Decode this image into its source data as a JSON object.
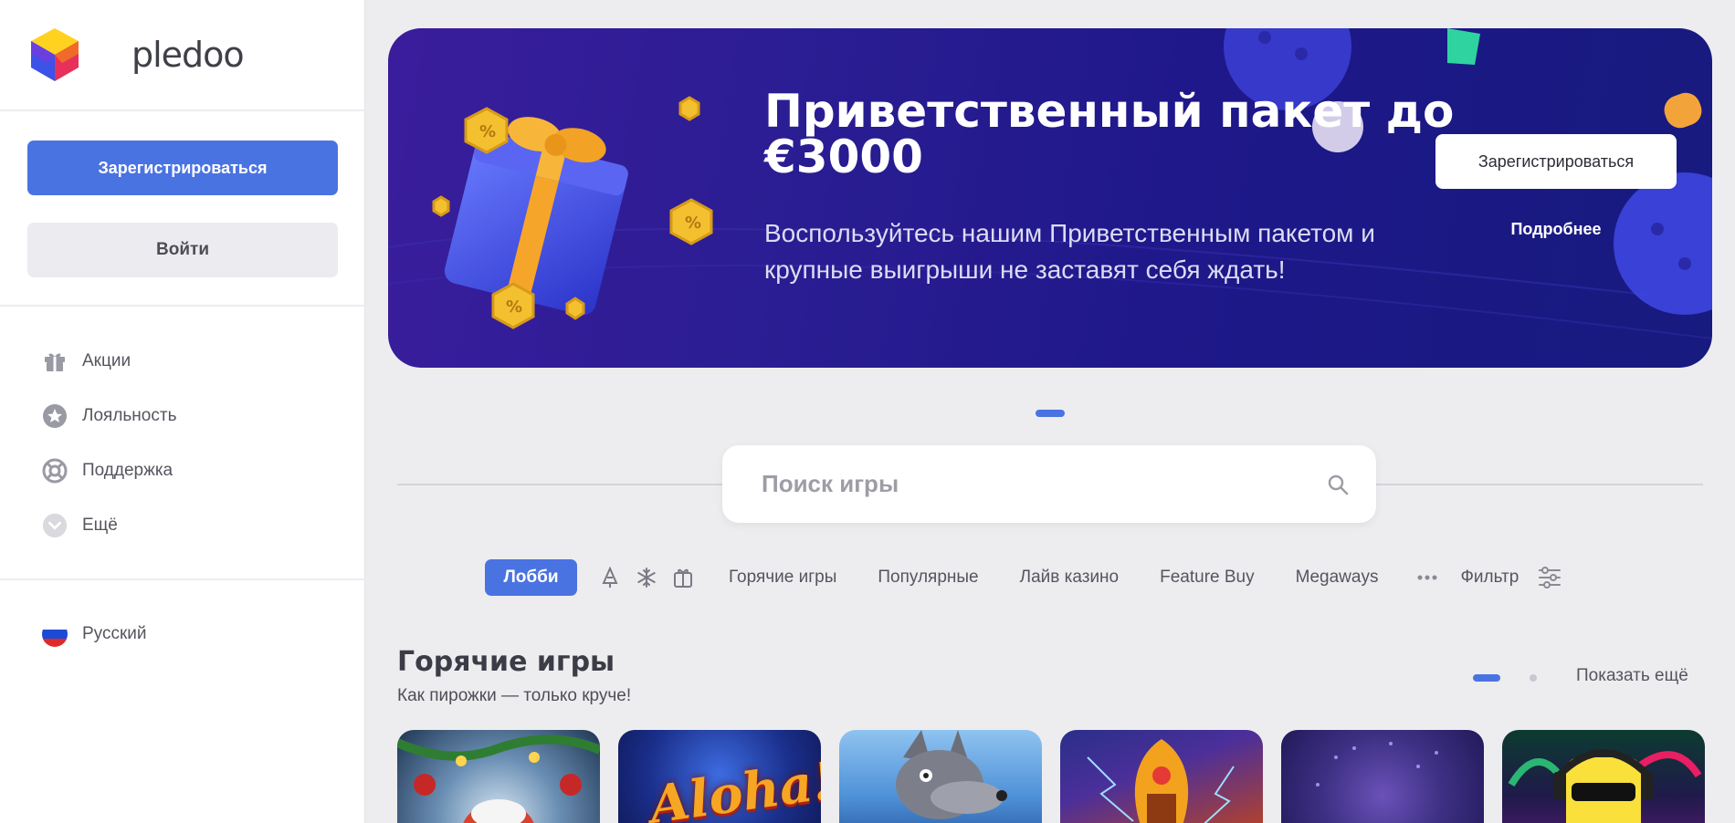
{
  "app": {
    "name": "pledoo"
  },
  "colors": {
    "accent": "#4a73e2",
    "banner_bg": "#231b8f",
    "sidebar_bg": "#ffffff",
    "page_bg": "#ededf0"
  },
  "sidebar": {
    "register_label": "Зарегистрироваться",
    "login_label": "Войти",
    "nav_items": [
      {
        "label": "Акции",
        "icon": "gift-icon"
      },
      {
        "label": "Лояльность",
        "icon": "star-icon"
      },
      {
        "label": "Поддержка",
        "icon": "lifebuoy-icon"
      },
      {
        "label": "Ещё",
        "icon": "chevron-down-icon"
      }
    ],
    "language": {
      "label": "Русский",
      "icon": "russia-flag-icon"
    }
  },
  "banner": {
    "title": "Приветственный пакет до €3000",
    "subtitle": "Воспользуйтесь нашим Приветственным пакетом и крупные выигрыши не заставят себя ждать!",
    "cta_label": "Зарегистрироваться",
    "more_label": "Подробнее",
    "slides_total": 1,
    "slide_active": 1
  },
  "search": {
    "placeholder": "Поиск игры"
  },
  "categories": {
    "active": "Лобби",
    "icons": [
      "christmas-tree-icon",
      "snowflake-icon",
      "gift-box-icon"
    ],
    "items": [
      "Горячие игры",
      "Популярные",
      "Лайв казино",
      "Feature Buy",
      "Megaways"
    ],
    "filter_label": "Фильтр"
  },
  "hot_games": {
    "title": "Горячие игры",
    "subtitle": "Как пирожки — только круче!",
    "show_more": "Показать ещё",
    "cards": [
      {
        "name": "christmas-game"
      },
      {
        "name": "aloha",
        "title": "Aloha!"
      },
      {
        "name": "wolf-game"
      },
      {
        "name": "egypt-game"
      },
      {
        "name": "purple-game"
      },
      {
        "name": "neon-game"
      }
    ]
  }
}
